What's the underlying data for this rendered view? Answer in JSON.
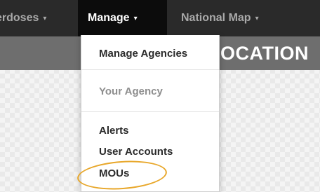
{
  "navbar": {
    "items": [
      {
        "label": "erdoses",
        "caret": "▾"
      },
      {
        "label": "Manage",
        "caret": "▾"
      },
      {
        "label": "National Map",
        "caret": "▾"
      }
    ]
  },
  "page_header": {
    "title": "OCATION"
  },
  "manage_menu": {
    "items": [
      {
        "label": "Manage Agencies"
      },
      {
        "label": "Your Agency"
      },
      {
        "label": "Alerts"
      },
      {
        "label": "User Accounts"
      },
      {
        "label": "MOUs"
      }
    ]
  },
  "colors": {
    "navbar_bg": "#2a2a2a",
    "active_nav_bg": "#0c0c0c",
    "header_bg": "#6e6e6e",
    "annotation": "#e8a72a"
  }
}
